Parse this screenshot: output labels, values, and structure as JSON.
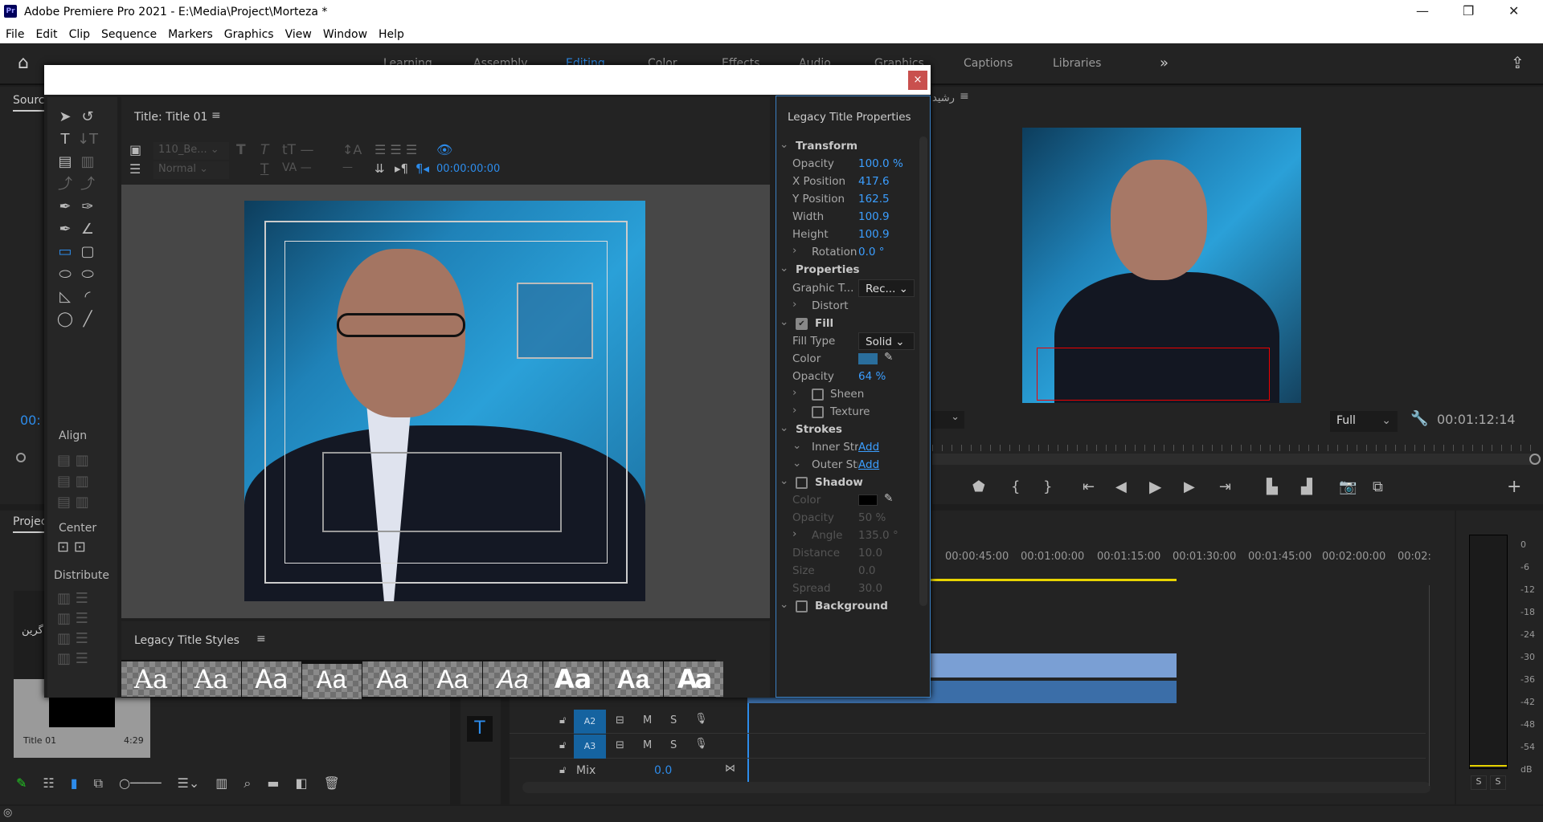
{
  "app": {
    "title": "Adobe Premiere Pro 2021 - E:\\Media\\Project\\Morteza *",
    "logo": "Pr"
  },
  "menu": [
    "File",
    "Edit",
    "Clip",
    "Sequence",
    "Markers",
    "Graphics",
    "View",
    "Window",
    "Help"
  ],
  "workspaces": [
    "Learning",
    "Assembly",
    "Editing",
    "Color",
    "Effects",
    "Audio",
    "Graphics",
    "Captions",
    "Libraries"
  ],
  "source_tab": "Source",
  "project_tab": "Projec",
  "source_timecode": "00:",
  "program": {
    "name": "رشید",
    "zoom": "Full",
    "timecode": "00:01:12:14"
  },
  "timeline": {
    "ruler": [
      "00:00:45:00",
      "00:01:00:00",
      "00:01:15:00",
      "00:01:30:00",
      "00:01:45:00",
      "00:02:00:00",
      "00:02:"
    ],
    "tracks": [
      {
        "name": "A2",
        "m": "M",
        "s": "S"
      },
      {
        "name": "A3",
        "m": "M",
        "s": "S"
      }
    ],
    "mix_label": "Mix",
    "mix_value": "0.0"
  },
  "meter": {
    "scale": [
      "0",
      "-6",
      "-12",
      "-18",
      "-24",
      "-30",
      "-36",
      "-42",
      "-48",
      "-54",
      "dB"
    ],
    "solo": [
      "S",
      "S"
    ]
  },
  "project": {
    "clip_name": "Title 01",
    "clip_duration": "4:29",
    "thumb_text": "گرین"
  },
  "dialog": {
    "close": "×",
    "title_panel": "Title: Title 01",
    "font": "110_Be...",
    "font_style": "Normal",
    "timecode": "00:00:00:00",
    "align_label": "Align",
    "center_label": "Center",
    "distribute_label": "Distribute",
    "styles_label": "Legacy Title Styles",
    "style_sample": "Aa",
    "props": {
      "header": "Legacy Title Properties",
      "transform": "Transform",
      "opacity_l": "Opacity",
      "opacity": "100.0 %",
      "xpos_l": "X Position",
      "xpos": "417.6",
      "ypos_l": "Y Position",
      "ypos": "162.5",
      "width_l": "Width",
      "width": "100.9",
      "height_l": "Height",
      "height": "100.9",
      "rotation_l": "Rotation",
      "rotation": "0.0 °",
      "properties": "Properties",
      "graphic_type_l": "Graphic T...",
      "graphic_type": "Rec...",
      "distort": "Distort",
      "fill": "Fill",
      "fill_checked": true,
      "fill_type_l": "Fill Type",
      "fill_type": "Solid",
      "color_l": "Color",
      "fill_color": "#2a6e9c",
      "fill_opacity_l": "Opacity",
      "fill_opacity": "64 %",
      "sheen": "Sheen",
      "texture": "Texture",
      "strokes": "Strokes",
      "inner": "Inner Stro...",
      "outer": "Outer Str...",
      "add": "Add",
      "shadow": "Shadow",
      "shadow_color_l": "Color",
      "shadow_color": "#000000",
      "shadow_opacity_l": "Opacity",
      "shadow_opacity": "50 %",
      "angle_l": "Angle",
      "angle": "135.0 °",
      "distance_l": "Distance",
      "distance": "10.0",
      "size_l": "Size",
      "size": "0.0",
      "spread_l": "Spread",
      "spread": "30.0",
      "background": "Background"
    }
  },
  "colors": {
    "accent": "#2d8ceb",
    "track_label": "#1563a0",
    "close": "#c9504e",
    "playhead": "#e8d400"
  }
}
